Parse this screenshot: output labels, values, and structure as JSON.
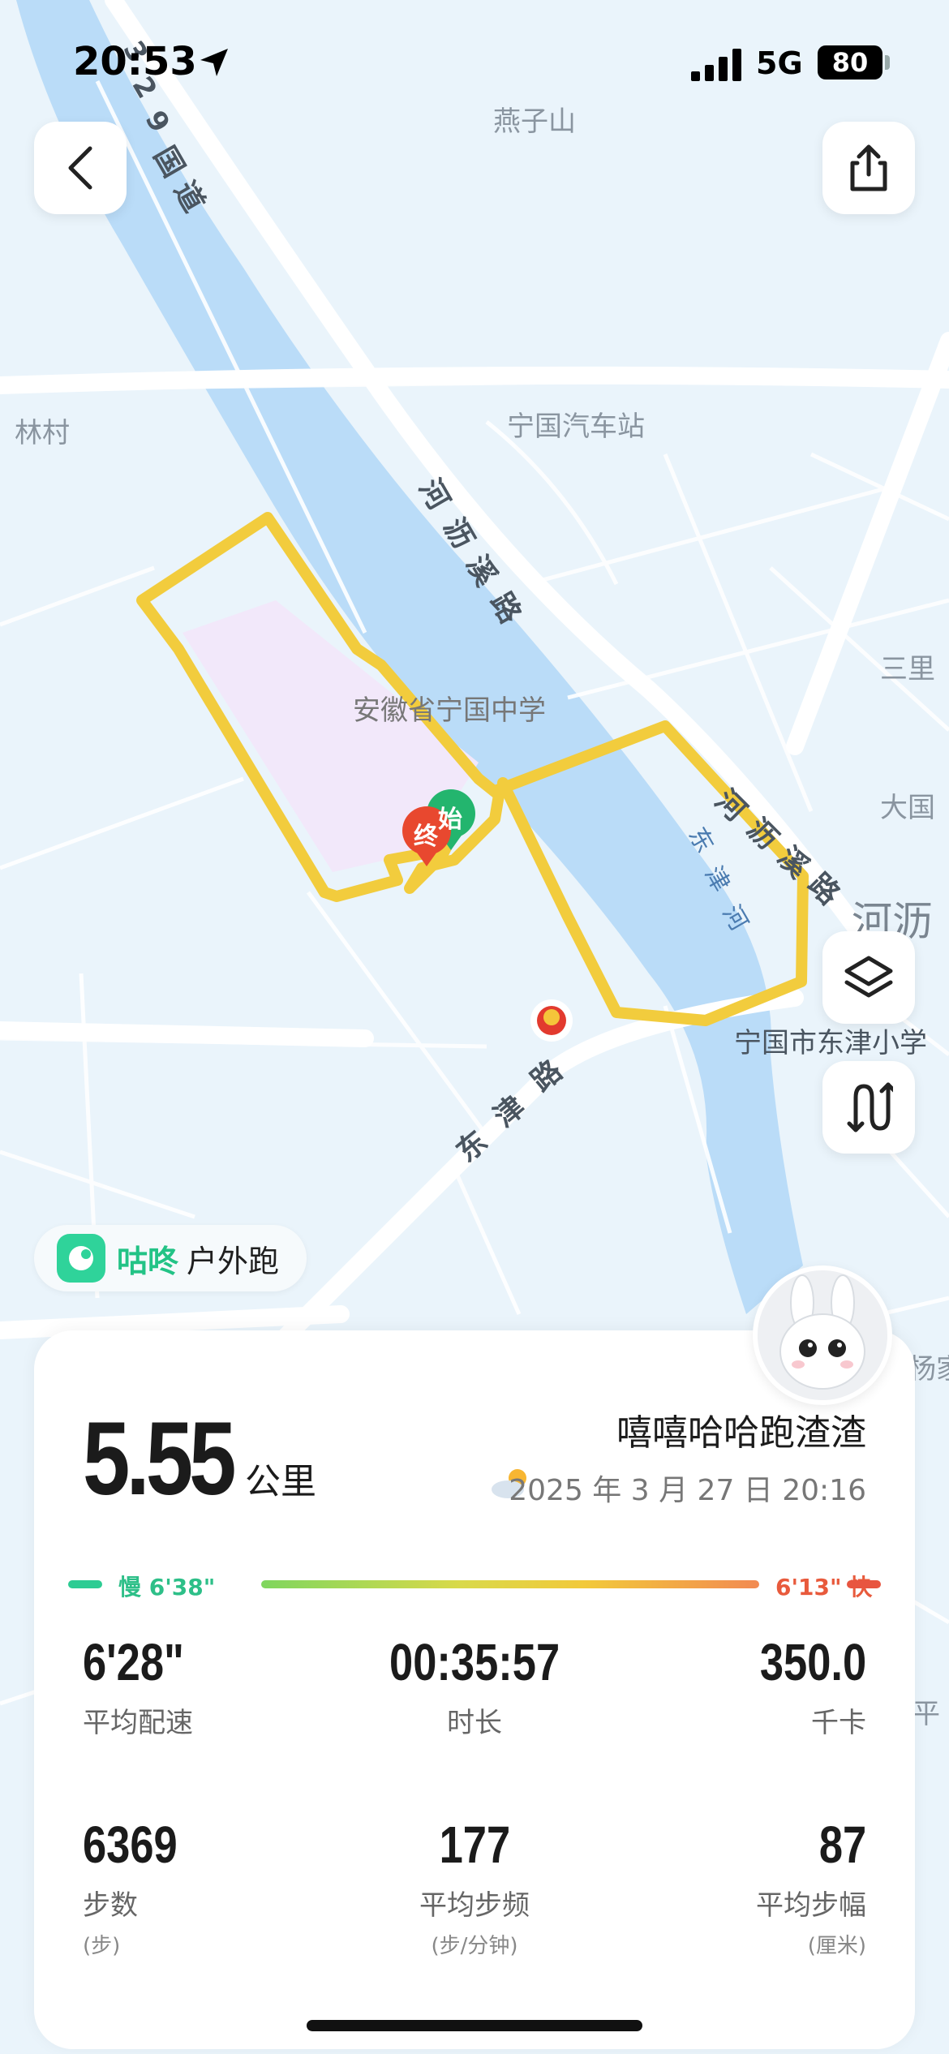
{
  "status_bar": {
    "time": "20:53",
    "network": "5G",
    "battery": "80"
  },
  "map": {
    "labels": {
      "yanzishan": "燕子山",
      "lincun": "林村",
      "station": "宁国汽车站",
      "school": "安徽省宁国中学",
      "sanli": "三里",
      "daguo": "大国",
      "heli": "河沥",
      "primary": "宁国市东津小学",
      "yangjia": "杨家",
      "ping": "平"
    },
    "roads": {
      "national": [
        "3",
        "2",
        "9",
        "国",
        "道"
      ],
      "helixi_1": [
        "河",
        "沥",
        "溪",
        "路"
      ],
      "helixi_2": [
        "河",
        "沥",
        "溪",
        "路"
      ],
      "dongjin": [
        "东",
        "津",
        "路"
      ]
    },
    "river": [
      "东",
      "津",
      "河"
    ],
    "markers": {
      "start": "始",
      "end": "终"
    }
  },
  "brand": {
    "name": "咕咚",
    "activity": "户外跑"
  },
  "summary": {
    "distance": "5.55",
    "distance_unit": "公里",
    "username": "嘻嘻哈哈跑渣渣",
    "datetime": "2025 年 3 月 27 日 20:16"
  },
  "pace_legend": {
    "slow": "慢 6'38\"",
    "fast": "6'13\" 快"
  },
  "stats": [
    {
      "value": "6'28\"",
      "label": "平均配速",
      "sub": ""
    },
    {
      "value": "00:35:57",
      "label": "时长",
      "sub": ""
    },
    {
      "value": "350.0",
      "label": "千卡",
      "sub": ""
    },
    {
      "value": "6369",
      "label": "步数",
      "sub": "(步)"
    },
    {
      "value": "177",
      "label": "平均步频",
      "sub": "(步/分钟)"
    },
    {
      "value": "87",
      "label": "平均步幅",
      "sub": "(厘米)"
    }
  ],
  "colors": {
    "route": "#f2cc3d",
    "river": "#b9dbf7",
    "accent": "#2fd39a"
  }
}
